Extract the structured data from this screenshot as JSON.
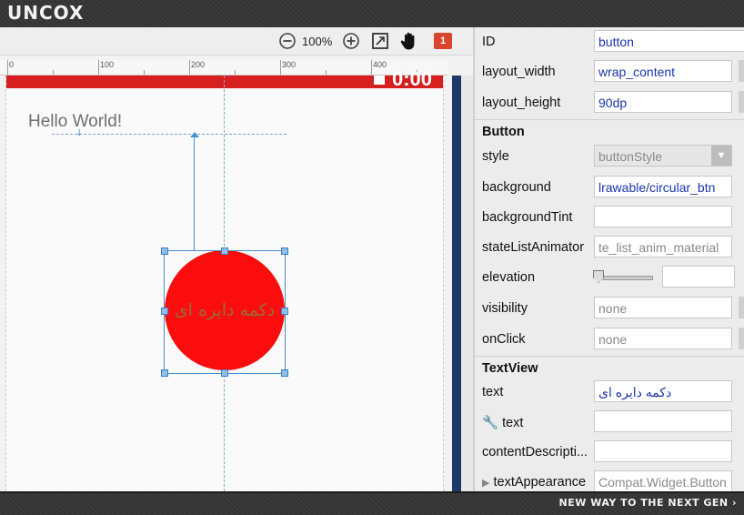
{
  "brand": {
    "name": "UNCOX",
    "tagline": "NEW WAY TO THE NEXT GEN ›"
  },
  "toolbar": {
    "zoom_label": "100%",
    "badge_count": "1",
    "icons": [
      "zoom-out-icon",
      "zoom-in-icon",
      "fit-screen-icon",
      "hand-pan-icon"
    ]
  },
  "ruler": {
    "ticks": [
      "0",
      "100",
      "200",
      "300",
      "400"
    ]
  },
  "device": {
    "status_time": "0:00",
    "hello_text": "Hello World!",
    "button_text": "دکمه دایره ای",
    "status_color": "#d61f1f",
    "button_color": "#fb0d0d"
  },
  "properties": {
    "id": {
      "label": "ID",
      "value": "button"
    },
    "layout_width": {
      "label": "layout_width",
      "value": "wrap_content"
    },
    "layout_height": {
      "label": "layout_height",
      "value": "90dp"
    },
    "button_section": "Button",
    "style": {
      "label": "style",
      "value": "buttonStyle"
    },
    "background": {
      "label": "background",
      "value": "lrawable/circular_btn"
    },
    "backgroundTint": {
      "label": "backgroundTint",
      "value": ""
    },
    "stateListAnimator": {
      "label": "stateListAnimator",
      "value": "te_list_anim_material"
    },
    "elevation": {
      "label": "elevation",
      "value": ""
    },
    "visibility": {
      "label": "visibility",
      "value": "none"
    },
    "onClick": {
      "label": "onClick",
      "value": "none"
    },
    "textview_section": "TextView",
    "text": {
      "label": "text",
      "value": "دکمه دایره ای"
    },
    "text_tools": {
      "label": "text",
      "value": ""
    },
    "contentDescription": {
      "label": "contentDescripti...",
      "value": ""
    },
    "textAppearance": {
      "label": "textAppearance",
      "value": "Compat.Widget.Button"
    }
  }
}
